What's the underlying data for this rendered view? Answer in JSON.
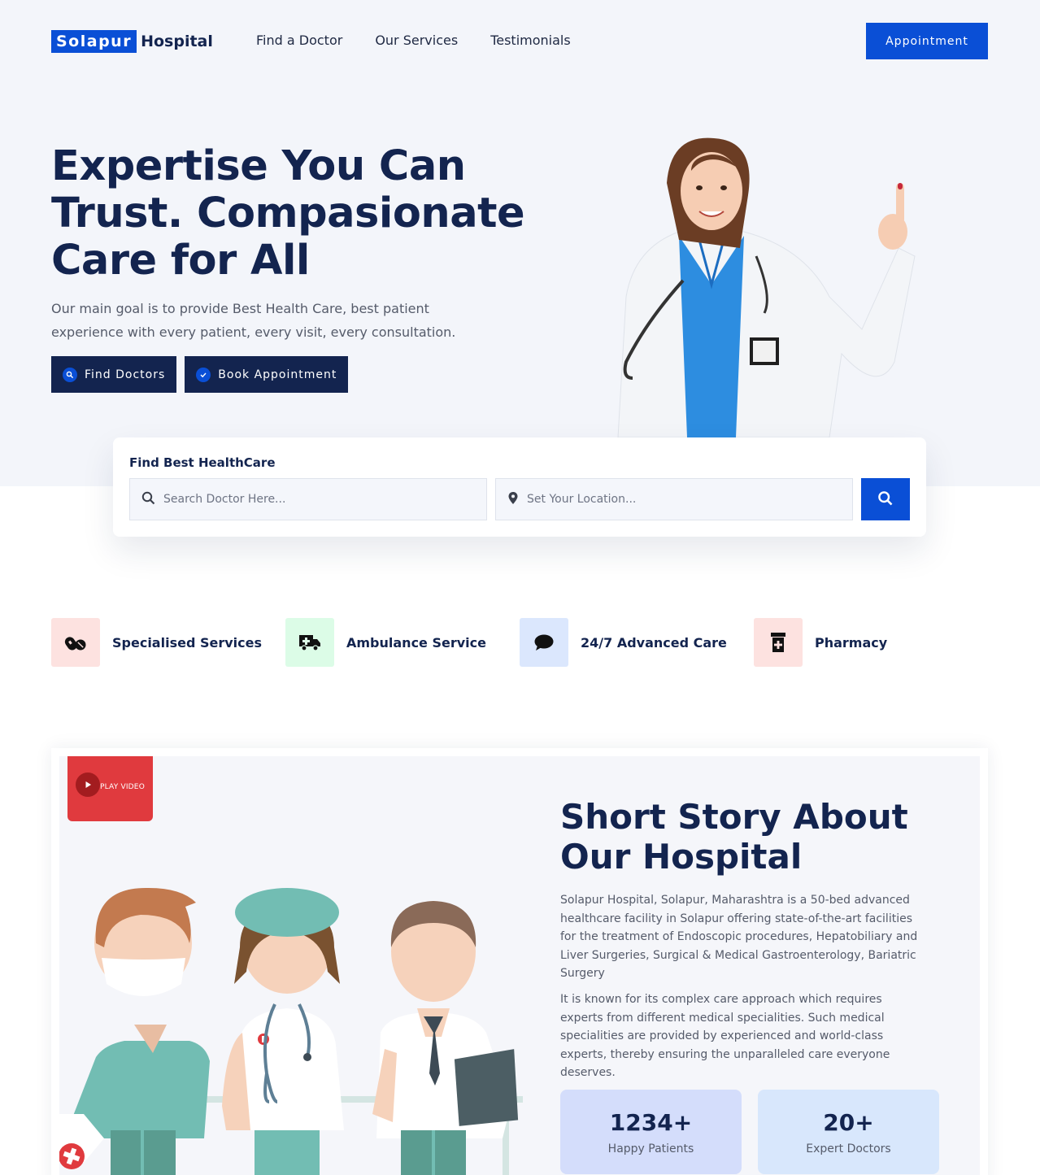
{
  "brand": {
    "name_box": "Solapur",
    "name_rest": "Hospital",
    "accent": "#0a4fd6",
    "navy": "#13244f"
  },
  "nav": {
    "links": [
      "Find a Doctor",
      "Our Services",
      "Testimonials"
    ],
    "appointment_label": "Appointment"
  },
  "hero": {
    "title": "Expertise You Can Trust. Compasionate Care for All",
    "subtitle": "Our main goal is to provide Best Health Care, best patient experience with every patient, every visit, every consultation.",
    "btn_find": "Find Doctors",
    "btn_book": "Book Appointment",
    "btn_find_icon": "search-icon",
    "btn_book_icon": "check-icon"
  },
  "search": {
    "title": "Find Best HealthCare",
    "doctor_placeholder": "Search Doctor Here...",
    "location_placeholder": "Set Your Location..."
  },
  "features": [
    {
      "label": "Specialised Services",
      "icon": "pills-icon",
      "bg": "#fde2e0"
    },
    {
      "label": "Ambulance Service",
      "icon": "ambulance-icon",
      "bg": "#dcfce7"
    },
    {
      "label": "24/7 Advanced Care",
      "icon": "chat-bubble-icon",
      "bg": "#dbe7fd"
    },
    {
      "label": "Pharmacy",
      "icon": "prescription-bottle-icon",
      "bg": "#fde2e0"
    }
  ],
  "about": {
    "play_label": "PLAY VIDEO",
    "title": "Short Story About Our Hospital",
    "p1": "Solapur Hospital, Solapur, Maharashtra is a 50-bed advanced healthcare facility in Solapur offering state-of-the-art facilities for the treatment of Endoscopic procedures, Hepatobiliary and Liver Surgeries, Surgical & Medical Gastroenterology, Bariatric Surgery",
    "p2": "It is known for its complex care approach which requires experts from different medical specialities. Such medical specialities are provided by experienced and world-class experts, thereby ensuring the unparalleled care everyone deserves.",
    "stats": [
      {
        "value": "1234+",
        "label": "Happy Patients",
        "bg": "#d4ddfb"
      },
      {
        "value": "20+",
        "label": "Expert Doctors",
        "bg": "#d8e7fc"
      }
    ]
  }
}
